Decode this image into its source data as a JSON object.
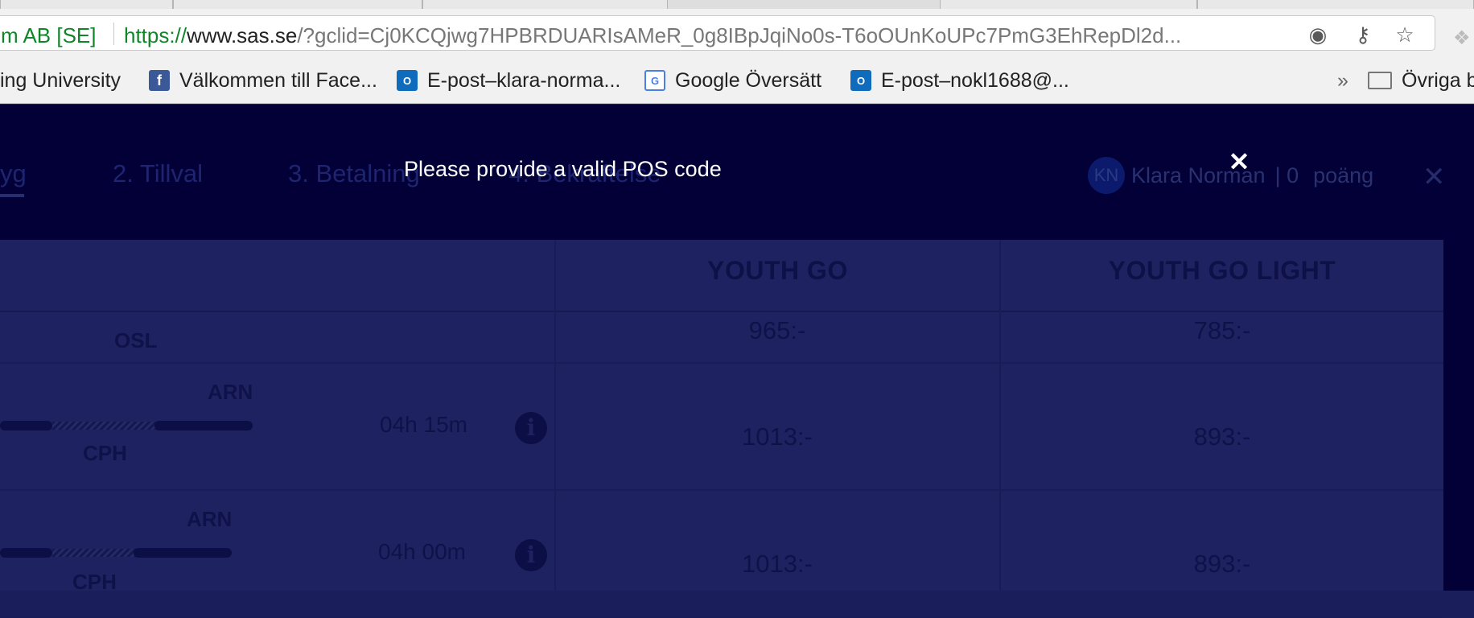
{
  "browser": {
    "site_identity": "m AB [SE]",
    "url_scheme": "https://",
    "url_host": "www.sas.se",
    "url_rest": "/?gclid=Cj0KCQjwg7HPBRDUARIsAMeR_0g8IBpJqiNo0s-T6oOUnKoUPc7PmG3EhRepDl2d...",
    "bookmarks": [
      {
        "label": "ing University",
        "icon": "none"
      },
      {
        "label": "Välkommen till Face...",
        "icon": "facebook-icon"
      },
      {
        "label": "E-post–klara-norma...",
        "icon": "outlook-icon"
      },
      {
        "label": "Google Översätt",
        "icon": "google-translate-icon"
      },
      {
        "label": "E-post–nokl1688@...",
        "icon": "outlook-icon"
      }
    ],
    "overflow_chevron": "»",
    "other_bookmarks": "Övriga b"
  },
  "header": {
    "steps": [
      "yg",
      "2. Tillval",
      "3. Betalning",
      "4. Bekräftelse"
    ],
    "user_initials": "KN",
    "user_name": "Klara Norman",
    "points_value": "| 0",
    "points_label": "poäng"
  },
  "table": {
    "columns": [
      "YOUTH GO",
      "YOUTH GO LIGHT"
    ],
    "partial_row": {
      "via": "OSL",
      "price_go": "965:-",
      "price_light": "785:-"
    },
    "rows": [
      {
        "to": "ARN",
        "via": "CPH",
        "duration": "04h 15m",
        "price_go": "1013:-",
        "price_light": "893:-"
      },
      {
        "to": "ARN",
        "via": "CPH",
        "duration": "04h 00m",
        "price_go": "1013:-",
        "price_light": "893:-"
      }
    ]
  },
  "alert": {
    "message": "Please provide a valid POS code",
    "close_glyph": "✕"
  }
}
